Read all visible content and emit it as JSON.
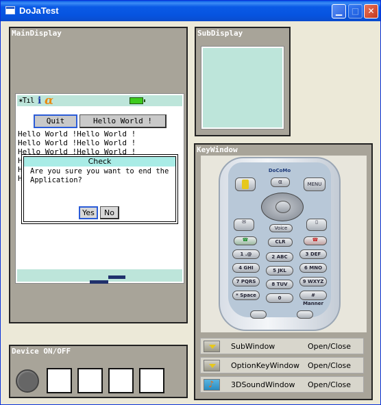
{
  "window": {
    "title": "DoJaTest"
  },
  "main_display": {
    "label": "MainDisplay",
    "status": {
      "signal": "✶Tıl"
    },
    "softkeys": {
      "quit": "Quit",
      "hello": "Hello World !"
    },
    "lines": [
      "Hello World !Hello World !",
      "Hello World !Hello World !",
      "Hello World !Hello World !",
      "H",
      "H",
      "H"
    ],
    "dialog": {
      "title": "Check",
      "message": "Are you sure you want to end the Application?",
      "yes": "Yes",
      "no": "No"
    }
  },
  "sub_display": {
    "label": "SubDisplay"
  },
  "key_window": {
    "label": "KeyWindow",
    "phone": {
      "logo": "DoCoMo",
      "menu": "MENU",
      "voice": "Voice",
      "clr": "CLR",
      "keys": [
        [
          "1 .@",
          "2 ABC",
          "3 DEF"
        ],
        [
          "4 GHI",
          "5 JKL",
          "6 MNO"
        ],
        [
          "7 PQRS",
          "8 TUV",
          "9 WXYZ"
        ],
        [
          "* Space",
          "0",
          "# Manner"
        ]
      ]
    },
    "rows": [
      {
        "name": "SubWindow",
        "action": "Open/Close",
        "icon": "arrow-down-icon"
      },
      {
        "name": "OptionKeyWindow",
        "action": "Open/Close",
        "icon": "arrow-down-icon"
      },
      {
        "name": "3DSoundWindow",
        "action": "Open/Close",
        "icon": "music-note-icon"
      }
    ]
  },
  "device": {
    "label": "Device ON/OFF"
  },
  "colors": {
    "title_bar": "#0a5ae6",
    "panel_bg": "#a8a499",
    "lcd_bg": "#bde5da",
    "focus_border": "#2a5bd7"
  }
}
